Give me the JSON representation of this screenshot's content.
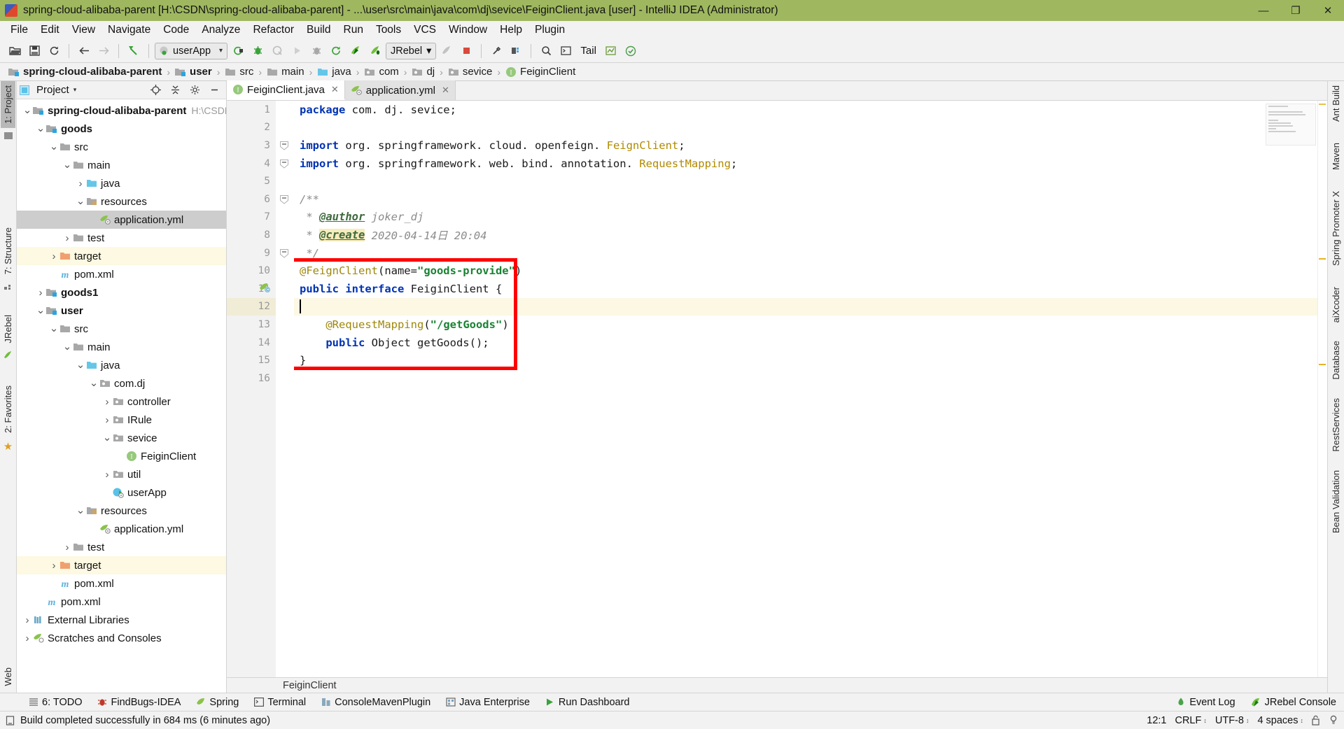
{
  "window": {
    "title": "spring-cloud-alibaba-parent [H:\\CSDN\\spring-cloud-alibaba-parent] - ...\\user\\src\\main\\java\\com\\dj\\sevice\\FeiginClient.java [user] - IntelliJ IDEA (Administrator)",
    "minimize": "—",
    "maximize": "❐",
    "close": "✕"
  },
  "menubar": {
    "items": [
      "File",
      "Edit",
      "View",
      "Navigate",
      "Code",
      "Analyze",
      "Refactor",
      "Build",
      "Run",
      "Tools",
      "VCS",
      "Window",
      "Help",
      "Plugin"
    ]
  },
  "toolbar": {
    "run_config": "userApp",
    "jrebel_config": "JRebel",
    "tail_label": "Tail",
    "icons": [
      "open-folder-icon",
      "save-all-icon",
      "sync-icon",
      "back-icon",
      "forward-icon",
      "undo-icon",
      "run-config-selector",
      "build-icon",
      "debug-icon",
      "coverage-icon",
      "run-icon",
      "attach-debug-icon",
      "rerun-icon",
      "jrebel-run-icon",
      "jrebel-debug-icon",
      "jrebel-config-selector",
      "stop-icon",
      "settings-icon",
      "project-structure-icon",
      "search-everywhere-icon",
      "tail-icon",
      "console-icon",
      "checkmark-icon"
    ]
  },
  "breadcrumb": {
    "items": [
      {
        "label": "spring-cloud-alibaba-parent",
        "icon": "module-folder-icon",
        "bold": true
      },
      {
        "label": "user",
        "icon": "module-folder-icon",
        "bold": true
      },
      {
        "label": "src",
        "icon": "folder-icon",
        "bold": false
      },
      {
        "label": "main",
        "icon": "folder-icon",
        "bold": false
      },
      {
        "label": "java",
        "icon": "source-folder-icon",
        "bold": false
      },
      {
        "label": "com",
        "icon": "package-icon",
        "bold": false
      },
      {
        "label": "dj",
        "icon": "package-icon",
        "bold": false
      },
      {
        "label": "sevice",
        "icon": "package-icon",
        "bold": false
      },
      {
        "label": "FeiginClient",
        "icon": "interface-icon",
        "bold": false
      }
    ],
    "separator": "›"
  },
  "left_rail": {
    "items": [
      "1: Project",
      "7: Structure",
      "JRebel",
      "2: Favorites"
    ],
    "active": "1: Project"
  },
  "right_rail": {
    "items": [
      "Ant Build",
      "Maven",
      "Spring Promoter X",
      "aiXcoder",
      "Database",
      "RestServices",
      "Bean Validation",
      "Web"
    ]
  },
  "project_panel": {
    "title": "Project",
    "caret": "▾",
    "actions": [
      "locate-icon",
      "collapse-all-icon",
      "settings-icon",
      "hide-icon"
    ],
    "tree": [
      {
        "depth": 0,
        "label": "spring-cloud-alibaba-parent",
        "sub": "H:\\CSDN\\sprin",
        "icon": "module-folder-icon",
        "arrow": "down",
        "bold": true,
        "state": "normal"
      },
      {
        "depth": 1,
        "label": "goods",
        "sub": "",
        "icon": "module-folder-icon",
        "arrow": "down",
        "bold": true,
        "state": "normal"
      },
      {
        "depth": 2,
        "label": "src",
        "sub": "",
        "icon": "folder-icon",
        "arrow": "down",
        "bold": false,
        "state": "normal"
      },
      {
        "depth": 3,
        "label": "main",
        "sub": "",
        "icon": "folder-icon",
        "arrow": "down",
        "bold": false,
        "state": "normal"
      },
      {
        "depth": 4,
        "label": "java",
        "sub": "",
        "icon": "source-folder-icon",
        "arrow": "right",
        "bold": false,
        "state": "normal"
      },
      {
        "depth": 4,
        "label": "resources",
        "sub": "",
        "icon": "resource-folder-icon",
        "arrow": "down",
        "bold": false,
        "state": "normal"
      },
      {
        "depth": 5,
        "label": "application.yml",
        "sub": "",
        "icon": "yaml-file-icon",
        "arrow": "none",
        "bold": false,
        "state": "selected"
      },
      {
        "depth": 3,
        "label": "test",
        "sub": "",
        "icon": "folder-icon",
        "arrow": "right",
        "bold": false,
        "state": "normal"
      },
      {
        "depth": 2,
        "label": "target",
        "sub": "",
        "icon": "target-folder-icon",
        "arrow": "right",
        "bold": false,
        "state": "modified"
      },
      {
        "depth": 2,
        "label": "pom.xml",
        "sub": "",
        "icon": "maven-file-icon",
        "arrow": "none",
        "bold": false,
        "state": "normal"
      },
      {
        "depth": 1,
        "label": "goods1",
        "sub": "",
        "icon": "module-folder-icon",
        "arrow": "right",
        "bold": true,
        "state": "normal"
      },
      {
        "depth": 1,
        "label": "user",
        "sub": "",
        "icon": "module-folder-icon",
        "arrow": "down",
        "bold": true,
        "state": "normal"
      },
      {
        "depth": 2,
        "label": "src",
        "sub": "",
        "icon": "folder-icon",
        "arrow": "down",
        "bold": false,
        "state": "normal"
      },
      {
        "depth": 3,
        "label": "main",
        "sub": "",
        "icon": "folder-icon",
        "arrow": "down",
        "bold": false,
        "state": "normal"
      },
      {
        "depth": 4,
        "label": "java",
        "sub": "",
        "icon": "source-folder-icon",
        "arrow": "down",
        "bold": false,
        "state": "normal"
      },
      {
        "depth": 5,
        "label": "com.dj",
        "sub": "",
        "icon": "package-icon",
        "arrow": "down",
        "bold": false,
        "state": "normal"
      },
      {
        "depth": 6,
        "label": "controller",
        "sub": "",
        "icon": "package-icon",
        "arrow": "right",
        "bold": false,
        "state": "normal"
      },
      {
        "depth": 6,
        "label": "IRule",
        "sub": "",
        "icon": "package-icon",
        "arrow": "right",
        "bold": false,
        "state": "normal"
      },
      {
        "depth": 6,
        "label": "sevice",
        "sub": "",
        "icon": "package-icon",
        "arrow": "down",
        "bold": false,
        "state": "normal"
      },
      {
        "depth": 7,
        "label": "FeiginClient",
        "sub": "",
        "icon": "interface-icon",
        "arrow": "none",
        "bold": false,
        "state": "normal"
      },
      {
        "depth": 6,
        "label": "util",
        "sub": "",
        "icon": "package-icon",
        "arrow": "right",
        "bold": false,
        "state": "normal"
      },
      {
        "depth": 6,
        "label": "userApp",
        "sub": "",
        "icon": "spring-app-icon",
        "arrow": "none",
        "bold": false,
        "state": "normal"
      },
      {
        "depth": 4,
        "label": "resources",
        "sub": "",
        "icon": "resource-folder-icon",
        "arrow": "down",
        "bold": false,
        "state": "normal"
      },
      {
        "depth": 5,
        "label": "application.yml",
        "sub": "",
        "icon": "yaml-file-icon",
        "arrow": "none",
        "bold": false,
        "state": "normal"
      },
      {
        "depth": 3,
        "label": "test",
        "sub": "",
        "icon": "folder-icon",
        "arrow": "right",
        "bold": false,
        "state": "normal"
      },
      {
        "depth": 2,
        "label": "target",
        "sub": "",
        "icon": "target-folder-icon",
        "arrow": "right",
        "bold": false,
        "state": "modified"
      },
      {
        "depth": 2,
        "label": "pom.xml",
        "sub": "",
        "icon": "maven-file-icon",
        "arrow": "none",
        "bold": false,
        "state": "normal"
      },
      {
        "depth": 1,
        "label": "pom.xml",
        "sub": "",
        "icon": "maven-file-icon",
        "arrow": "none",
        "bold": false,
        "state": "normal"
      },
      {
        "depth": 0,
        "label": "External Libraries",
        "sub": "",
        "icon": "external-libraries-icon",
        "arrow": "right",
        "bold": false,
        "state": "normal"
      },
      {
        "depth": 0,
        "label": "Scratches and Consoles",
        "sub": "",
        "icon": "scratches-icon",
        "arrow": "right",
        "bold": false,
        "state": "normal"
      }
    ]
  },
  "editor": {
    "tabs": [
      {
        "label": "FeiginClient.java",
        "icon": "interface-icon",
        "active": true,
        "close": "✕"
      },
      {
        "label": "application.yml",
        "icon": "yaml-file-icon",
        "active": false,
        "close": "✕"
      }
    ],
    "line_numbers": [
      "1",
      "2",
      "3",
      "4",
      "5",
      "6",
      "7",
      "8",
      "9",
      "10",
      "11",
      "12",
      "13",
      "14",
      "15",
      "16"
    ],
    "lines": [
      {
        "n": 1,
        "tokens": [
          {
            "t": "package",
            "c": "kw"
          },
          {
            "t": " com. dj. sevice;",
            "c": "plain"
          }
        ],
        "highlight": false
      },
      {
        "n": 2,
        "tokens": [],
        "highlight": false
      },
      {
        "n": 3,
        "tokens": [
          {
            "t": "import",
            "c": "kw"
          },
          {
            "t": " org. springframework. cloud. openfeign. ",
            "c": "plain"
          },
          {
            "t": "FeignClient",
            "c": "cls"
          },
          {
            "t": ";",
            "c": "plain"
          }
        ],
        "highlight": false,
        "fold": "minus"
      },
      {
        "n": 4,
        "tokens": [
          {
            "t": "import",
            "c": "kw"
          },
          {
            "t": " org. springframework. web. bind. annotation. ",
            "c": "plain"
          },
          {
            "t": "RequestMapping",
            "c": "cls"
          },
          {
            "t": ";",
            "c": "plain"
          }
        ],
        "highlight": false,
        "fold": "minus"
      },
      {
        "n": 5,
        "tokens": [],
        "highlight": false
      },
      {
        "n": 6,
        "tokens": [
          {
            "t": "/**",
            "c": "cmt"
          }
        ],
        "highlight": false,
        "fold": "minus"
      },
      {
        "n": 7,
        "tokens": [
          {
            "t": " * ",
            "c": "cmt"
          },
          {
            "t": "@author",
            "c": "tag"
          },
          {
            "t": " joker_dj",
            "c": "cmt"
          }
        ],
        "highlight": false
      },
      {
        "n": 8,
        "tokens": [
          {
            "t": " * ",
            "c": "cmt"
          },
          {
            "t": "@create",
            "c": "tag hlbg"
          },
          {
            "t": " 2020-04-14日 20:04",
            "c": "cmt"
          }
        ],
        "highlight": false
      },
      {
        "n": 9,
        "tokens": [
          {
            "t": " */",
            "c": "cmt"
          }
        ],
        "highlight": false,
        "fold": "minus"
      },
      {
        "n": 10,
        "tokens": [
          {
            "t": "@FeignClient",
            "c": "anno"
          },
          {
            "t": "(name=",
            "c": "plain"
          },
          {
            "t": "\"goods-provide\"",
            "c": "str"
          },
          {
            "t": ")",
            "c": "plain"
          }
        ],
        "highlight": false
      },
      {
        "n": 11,
        "tokens": [
          {
            "t": "public interface",
            "c": "kw"
          },
          {
            "t": " FeiginClient {",
            "c": "plain"
          }
        ],
        "highlight": false,
        "gutter_icon": "spring-bean-icon"
      },
      {
        "n": 12,
        "tokens": [],
        "highlight": true,
        "caret": true
      },
      {
        "n": 13,
        "tokens": [
          {
            "t": "    ",
            "c": "plain"
          },
          {
            "t": "@RequestMapping",
            "c": "anno"
          },
          {
            "t": "(",
            "c": "plain"
          },
          {
            "t": "\"/getGoods\"",
            "c": "str"
          },
          {
            "t": ")",
            "c": "plain"
          }
        ],
        "highlight": false
      },
      {
        "n": 14,
        "tokens": [
          {
            "t": "    ",
            "c": "plain"
          },
          {
            "t": "public",
            "c": "kw"
          },
          {
            "t": " Object getGoods();",
            "c": "plain"
          }
        ],
        "highlight": false
      },
      {
        "n": 15,
        "tokens": [
          {
            "t": "}",
            "c": "plain"
          }
        ],
        "highlight": false
      },
      {
        "n": 16,
        "tokens": [],
        "highlight": false
      }
    ],
    "status_text": "FeiginClient",
    "annotation_box": {
      "color": "#ff0000",
      "label": "code-highlight-box"
    }
  },
  "tool_window_bar": {
    "items": [
      {
        "label": "6: TODO",
        "icon": "todo-icon"
      },
      {
        "label": "FindBugs-IDEA",
        "icon": "findbugs-icon"
      },
      {
        "label": "Spring",
        "icon": "spring-icon"
      },
      {
        "label": "Terminal",
        "icon": "terminal-icon"
      },
      {
        "label": "ConsoleMavenPlugin",
        "icon": "maven-console-icon"
      },
      {
        "label": "Java Enterprise",
        "icon": "java-enterprise-icon"
      },
      {
        "label": "Run Dashboard",
        "icon": "run-dashboard-icon"
      }
    ],
    "right_items": [
      {
        "label": "Event Log",
        "icon": "event-log-icon"
      },
      {
        "label": "JRebel Console",
        "icon": "jrebel-icon"
      }
    ]
  },
  "statusbar": {
    "message": "Build completed successfully in 684 ms (6 minutes ago)",
    "caret_position": "12:1",
    "line_separator": "CRLF",
    "encoding": "UTF-8",
    "indent": "4 spaces",
    "caret_glyph": "↕",
    "lock_icon": "unlocked-icon",
    "inspection_icon": "inspections-icon"
  },
  "colors": {
    "title_bar": "#9fb860",
    "accent_red": "#ff0000",
    "selection": "#cdcdcd",
    "modified": "#fdf9e2",
    "keyword": "#0033b3",
    "string": "#1a8333",
    "annotation": "#9e880d",
    "comment": "#8c8c8c"
  }
}
